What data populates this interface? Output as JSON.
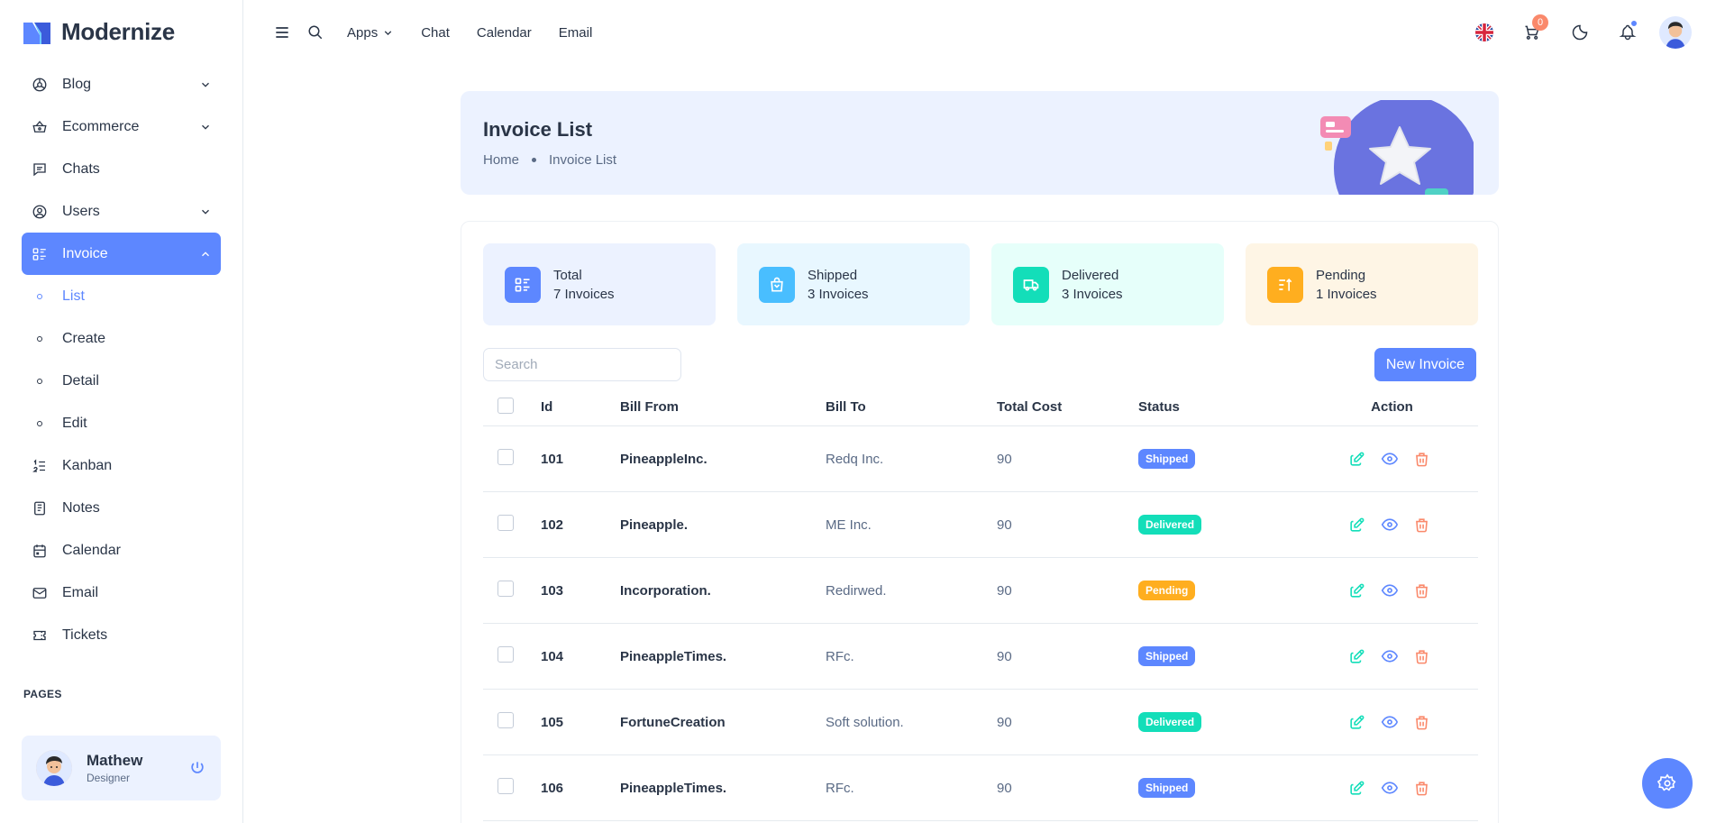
{
  "brand": {
    "name": "Modernize"
  },
  "sidebar": {
    "items": [
      {
        "label": "Blog",
        "icon": "blog-icon",
        "has_children": true
      },
      {
        "label": "Ecommerce",
        "icon": "basket-icon",
        "has_children": true
      },
      {
        "label": "Chats",
        "icon": "message-icon",
        "has_children": false
      },
      {
        "label": "Users",
        "icon": "user-circle-icon",
        "has_children": true
      },
      {
        "label": "Invoice",
        "icon": "list-details-icon",
        "has_children": true,
        "active": true
      },
      {
        "label": "List",
        "sub": true,
        "current": true
      },
      {
        "label": "Create",
        "sub": true
      },
      {
        "label": "Detail",
        "sub": true
      },
      {
        "label": "Edit",
        "sub": true
      },
      {
        "label": "Kanban",
        "icon": "list-numbers-icon"
      },
      {
        "label": "Notes",
        "icon": "notes-icon"
      },
      {
        "label": "Calendar",
        "icon": "calendar-icon"
      },
      {
        "label": "Email",
        "icon": "mail-icon"
      },
      {
        "label": "Tickets",
        "icon": "ticket-icon"
      }
    ],
    "section_label": "PAGES",
    "profile": {
      "name": "Mathew",
      "role": "Designer"
    }
  },
  "header": {
    "links": {
      "apps": "Apps",
      "chat": "Chat",
      "calendar": "Calendar",
      "email": "Email"
    },
    "cart_count": "0"
  },
  "breadcrumb": {
    "title": "Invoice List",
    "home": "Home",
    "current": "Invoice List"
  },
  "stats": [
    {
      "title": "Total",
      "value": "7 Invoices",
      "color": "#5d87ff",
      "bg": "#ecf2ff"
    },
    {
      "title": "Shipped",
      "value": "3 Invoices",
      "color": "#49beff",
      "bg": "#e8f7ff"
    },
    {
      "title": "Delivered",
      "value": "3 Invoices",
      "color": "#13deb9",
      "bg": "#e6fffa"
    },
    {
      "title": "Pending",
      "value": "1 Invoices",
      "color": "#ffae1f",
      "bg": "#fef5e5"
    }
  ],
  "search": {
    "placeholder": "Search"
  },
  "new_invoice_label": "New Invoice",
  "table": {
    "columns": {
      "id": "Id",
      "from": "Bill From",
      "to": "Bill To",
      "cost": "Total Cost",
      "status": "Status",
      "action": "Action"
    },
    "rows": [
      {
        "id": "101",
        "from": "PineappleInc.",
        "to": "Redq Inc.",
        "cost": "90",
        "status": "Shipped"
      },
      {
        "id": "102",
        "from": "Pineapple.",
        "to": "ME Inc.",
        "cost": "90",
        "status": "Delivered"
      },
      {
        "id": "103",
        "from": "Incorporation.",
        "to": "Redirwed.",
        "cost": "90",
        "status": "Pending"
      },
      {
        "id": "104",
        "from": "PineappleTimes.",
        "to": "RFc.",
        "cost": "90",
        "status": "Shipped"
      },
      {
        "id": "105",
        "from": "FortuneCreation",
        "to": "Soft solution.",
        "cost": "90",
        "status": "Delivered"
      },
      {
        "id": "106",
        "from": "PineappleTimes.",
        "to": "RFc.",
        "cost": "90",
        "status": "Shipped"
      }
    ]
  },
  "status_colors": {
    "Shipped": "#5d87ff",
    "Delivered": "#13deb9",
    "Pending": "#ffae1f"
  },
  "action_colors": {
    "edit": "#13deb9",
    "view": "#5d87ff",
    "delete": "#fa896b"
  }
}
